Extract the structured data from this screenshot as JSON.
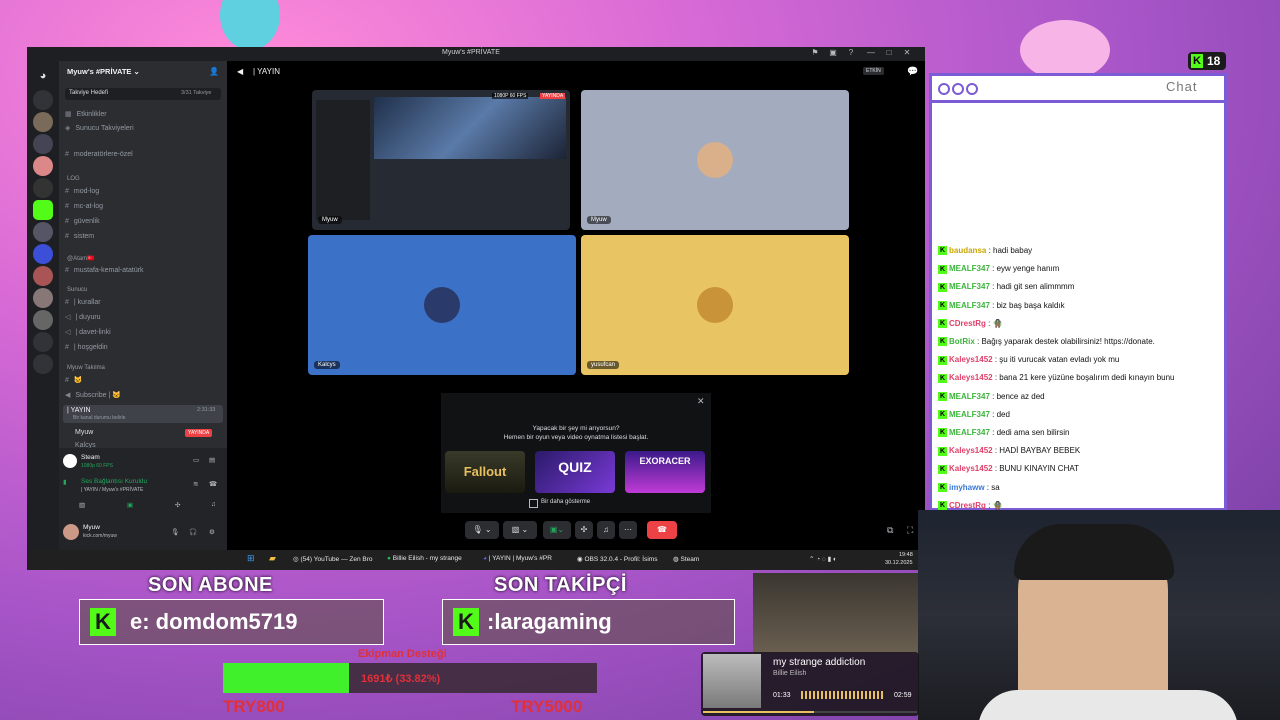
{
  "discord": {
    "window_title": "Myuw's #PRİVATE",
    "server_name": "Myuw's #PRİVATE",
    "boost_goal": "Takviye Hedefi",
    "boost_count": "3/31 Takviye",
    "top_items": [
      {
        "icon": "calendar-icon",
        "label": "Etkinlikler"
      },
      {
        "icon": "boost-icon",
        "label": "Sunucu Takviyeleri"
      }
    ],
    "channel_mod": "moderatörlere-özel",
    "cat_log": "LOG",
    "log_channels": [
      "mod-log",
      "mc-at-log",
      "güvenlik",
      "sistem"
    ],
    "cat_ataturk": "@Atam🇹🇷",
    "ataturk_channel": "mustafa-kemal-atatürk",
    "cat_sunucu": "Sunucu",
    "sunucu_channels": [
      "| kurallar",
      "| duyuru",
      "| davet-linki",
      "| hoşgeldin"
    ],
    "cat_takilma": "Myuw Takılma",
    "takilma_channels": [
      "🐱",
      "Subscribe | 🐱"
    ],
    "voice_channel": "| YAYIN",
    "voice_time": "2:31:33",
    "voice_subtitle": "Bir kanal durumu belirle",
    "voice_users": [
      {
        "name": "Myuw",
        "badge": "YAYINDA"
      },
      {
        "name": "Kalcys",
        "badge": ""
      }
    ],
    "activity_name": "Steam",
    "activity_sub": "1080p 60 FPS",
    "voice_status": "Ses Bağlantısı Kuruldu",
    "voice_status_sub": "| YAYIN / Myuw's #PRİVATE",
    "user_name": "Myuw",
    "user_sub": "kick.com/myuw",
    "header_channel": "| YAYIN",
    "header_badge": "ETKİN",
    "tiles": [
      {
        "label": "Myuw",
        "badge": "YAYINDA",
        "quality": "1080P 60 FPS"
      },
      {
        "label": "Myuw"
      },
      {
        "label": "Kalcys"
      },
      {
        "label": "yusufcan"
      }
    ],
    "activity_title": "Yapacak bir şey mi arıyorsun?",
    "activity_desc": "Hemen bir oyun veya video oynatma listesi başlat.",
    "games": [
      "Fallout",
      "QUIZ",
      "EXORACER"
    ],
    "dont_show": "Bir daha gösterme"
  },
  "taskbar": {
    "items": [
      "(54) YouTube — Zen Bro",
      "Billie Eilish - my strange",
      "| YAYIN | Myuw's #PR",
      "OBS 32.0.4 - Profil: İsims",
      "Steam"
    ],
    "time": "19:48",
    "date": "30.12.2025"
  },
  "kick_badge": {
    "count": "18"
  },
  "chat": {
    "title": "Chat",
    "messages": [
      {
        "user": "baudansa",
        "text": ": hadi babay",
        "color": "#c9a600"
      },
      {
        "user": "MEALF347",
        "text": ": eyw yenge hanım",
        "color": "#3cb43c"
      },
      {
        "user": "MEALF347",
        "text": ": hadi git sen alimmmm",
        "color": "#3cb43c"
      },
      {
        "user": "MEALF347",
        "text": ": biz baş başa kaldık",
        "color": "#3cb43c"
      },
      {
        "user": "CDrestRg",
        "text": ": 🧌",
        "color": "#e0406a"
      },
      {
        "user": "BotRix",
        "text": ": Bağış yaparak destek olabilirsiniz! https://donate.",
        "color": "#3cb43c"
      },
      {
        "user": "Kaleys1452",
        "text": ": şu iti vurucak vatan evladı yok mu",
        "color": "#e0406a"
      },
      {
        "user": "Kaleys1452",
        "text": ": bana 21 kere yüzüne boşalırım dedi kınayın bunu",
        "color": "#e0406a"
      },
      {
        "user": "MEALF347",
        "text": ": bence az ded",
        "color": "#3cb43c"
      },
      {
        "user": "MEALF347",
        "text": ": ded",
        "color": "#3cb43c"
      },
      {
        "user": "MEALF347",
        "text": ": dedi ama sen bilirsin",
        "color": "#3cb43c"
      },
      {
        "user": "Kaleys1452",
        "text": ": HADİ BAYBAY BEBEK",
        "color": "#e0406a"
      },
      {
        "user": "Kaleys1452",
        "text": ": BUNU KINAYIN CHAT",
        "color": "#e0406a"
      },
      {
        "user": "imyhaww",
        "text": ": sa",
        "color": "#3c78d6"
      },
      {
        "user": "CDrestRg",
        "text": ": 🧌",
        "color": "#e0406a"
      }
    ]
  },
  "overlay": {
    "son_abone_label": "SON ABONE",
    "son_abone_name": "e: domdom5719",
    "son_takipci_label": "SON TAKİPÇİ",
    "son_takipci_name": ":laragaming",
    "donation_title": "Ekipman Desteği",
    "donation_amount": "1691₺ (33.82%)",
    "donation_progress": 0.3382,
    "donation_current": "TRY800",
    "donation_goal": "TRY5000"
  },
  "spotify": {
    "song": "my strange addiction",
    "artist": "Billie Eilish",
    "elapsed": "01:33",
    "duration": "02:59",
    "progress": 0.52
  },
  "colors": {
    "kick_green": "#53fc18",
    "discord_blurple": "#5865f2",
    "live_red": "#ed4245",
    "chat_border": "#7b5bd6"
  }
}
